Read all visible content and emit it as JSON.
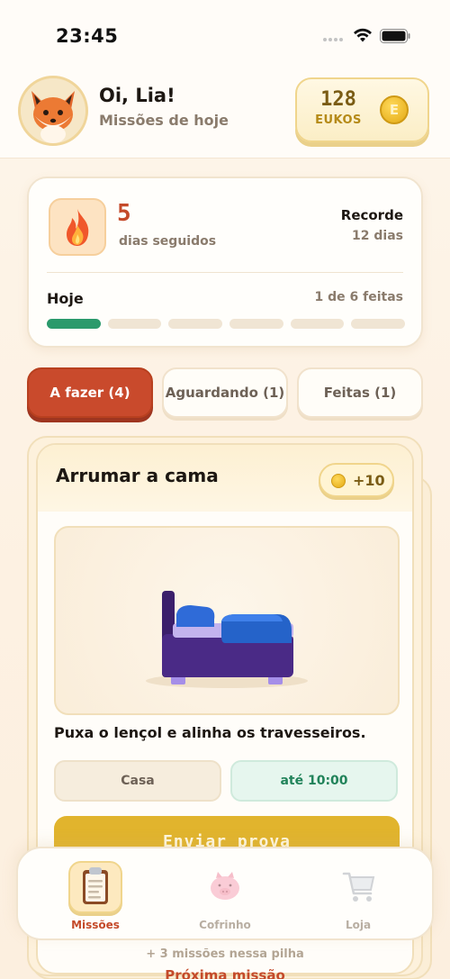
{
  "status_bar": {
    "time": "23:45"
  },
  "header": {
    "greeting": "Oi, Lia!",
    "subtitle": "Missões de hoje",
    "coins": {
      "count": "128",
      "label": "EUKOS",
      "icon_glyph": "E"
    }
  },
  "streak": {
    "days": "5",
    "days_label": "dias seguidos",
    "record_title": "Recorde",
    "record_value": "12 dias",
    "today_title": "Hoje",
    "today_progress": "1 de 6 feitas",
    "progress": {
      "done": 1,
      "total": 6
    }
  },
  "tabs": [
    {
      "label": "A fazer (4)",
      "active": true
    },
    {
      "label": "Aguardando (1)",
      "active": false
    },
    {
      "label": "Feitas (1)",
      "active": false
    }
  ],
  "mission": {
    "title": "Arrumar a cama",
    "reward": "+10",
    "description": "Puxa o lençol e alinha os travesseiros.",
    "location": "Casa",
    "due": "até 10:00",
    "submit_label": "Enviar prova",
    "illustration": "bed-icon"
  },
  "footer": {
    "more_text": "+ 3 missões nessa pilha",
    "next_link": "Próxima missão"
  },
  "nav": [
    {
      "label": "Missões",
      "icon": "clipboard-icon",
      "active": true
    },
    {
      "label": "Cofrinho",
      "icon": "piggy-bank-icon",
      "active": false
    },
    {
      "label": "Loja",
      "icon": "cart-icon",
      "active": false
    }
  ],
  "colors": {
    "accent": "#c94a2c",
    "gold": "#e1b42d",
    "success": "#2b9a6c",
    "background": "#fdf5ea"
  }
}
